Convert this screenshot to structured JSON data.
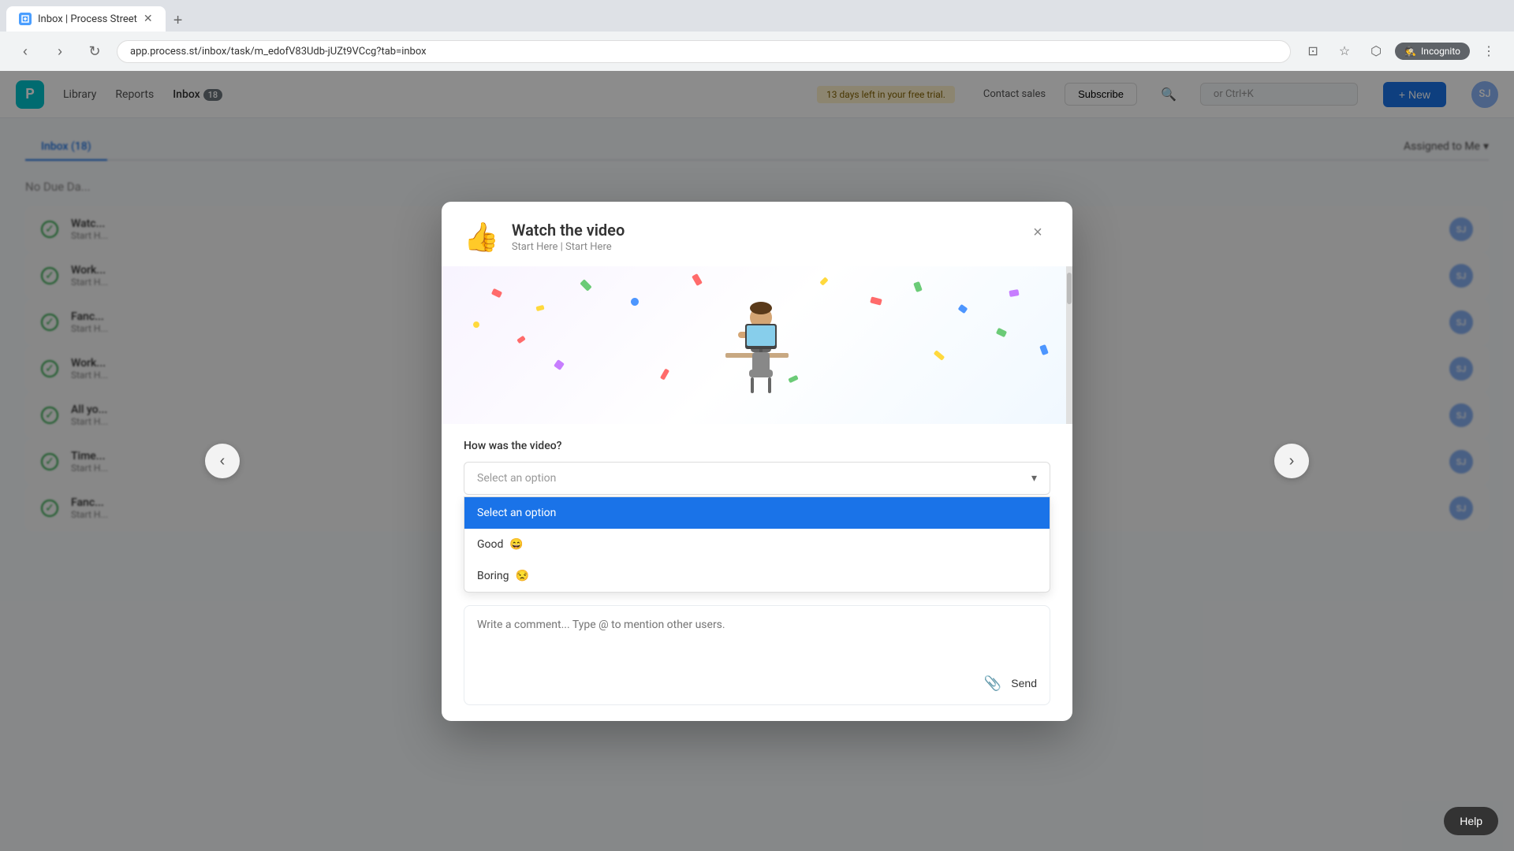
{
  "browser": {
    "tab_title": "Inbox | Process Street",
    "url": "app.process.st/inbox/task/m_edofV83Udb-jUZt9VCcg?tab=inbox",
    "incognito_label": "Incognito",
    "new_tab_icon": "+"
  },
  "header": {
    "logo_text": "P",
    "nav": {
      "library": "Library",
      "reports": "Reports",
      "inbox": "Inbox",
      "inbox_count": "18"
    },
    "trial_notice": "13 days left in your free trial.",
    "contact_sales": "Contact sales",
    "subscribe_label": "Subscribe",
    "search_placeholder": "or Ctrl+K",
    "new_button": "+ New",
    "avatar_initials": "SJ"
  },
  "inbox": {
    "tabs": [
      {
        "label": "Inbox (18)",
        "active": true
      },
      {
        "label": "Assigned to Me",
        "active": false
      }
    ],
    "section_title": "No Due Da...",
    "tasks": [
      {
        "name": "Watc...",
        "sub": "Start H..."
      },
      {
        "name": "Work...",
        "sub": "Start H..."
      },
      {
        "name": "Fanc...",
        "sub": "Start H..."
      },
      {
        "name": "Work...",
        "sub": "Start H..."
      },
      {
        "name": "All yo...",
        "sub": "Start H..."
      },
      {
        "name": "Time...",
        "sub": "Start H..."
      },
      {
        "name": "Fanc...",
        "sub": "Start H..."
      }
    ]
  },
  "modal": {
    "title": "Watch the video",
    "subtitle": "Start Here | Start Here",
    "close_icon": "×",
    "question": "How was the video?",
    "select_placeholder": "Select an option",
    "dropdown_options": [
      {
        "label": "Select an option",
        "selected": true,
        "emoji": ""
      },
      {
        "label": "Good",
        "selected": false,
        "emoji": "😄"
      },
      {
        "label": "Boring",
        "selected": false,
        "emoji": "😒"
      }
    ],
    "comment_placeholder": "Write a comment... Type @ to mention other users.",
    "send_label": "Send",
    "attach_icon": "📎",
    "modal_icon": "👍",
    "scrollbar_visible": true
  },
  "nav_arrows": {
    "left": "‹",
    "right": "›"
  },
  "help": {
    "label": "Help"
  },
  "colors": {
    "accent": "#1a73e8",
    "selected_bg": "#1a73e8",
    "logo_bg": "#00c4cc",
    "check_color": "#28a745"
  }
}
